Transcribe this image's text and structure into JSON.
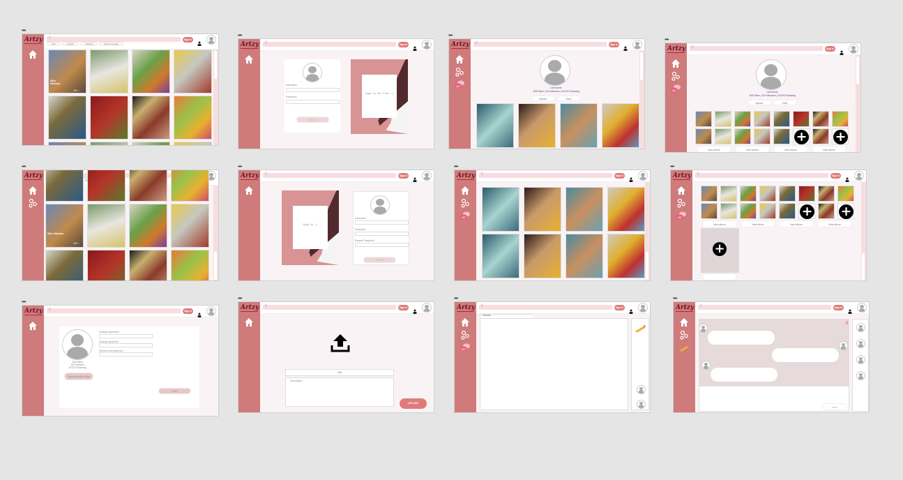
{
  "app": {
    "logo": "Artzy",
    "signin_label": "Sign In",
    "search_placeholder": ""
  },
  "feed": {
    "tabs": [
      "Post",
      "Artwork",
      "Abstract",
      "Most art people"
    ],
    "featured_author": "Silke Slavisku",
    "featured_likes": "100 ♡"
  },
  "login": {
    "username_label": "Username",
    "password_label": "Password",
    "button": "Sign In",
    "promo": "Sign in for Free :)"
  },
  "signup": {
    "username_label": "Username",
    "password_label": "Password",
    "repeat_label": "Repeat Password",
    "button": "Submit",
    "promo": "Sign in :)"
  },
  "profile": {
    "username": "Username",
    "stats": "1000 likes | 18 Followers | 10123 Following",
    "upload": "Upload",
    "save": "Save"
  },
  "albums": {
    "new_album": "New album"
  },
  "settings": {
    "change_username": "Change username",
    "change_password": "Change password",
    "repeat_password": "Repeat new password",
    "likes": "1000 likes",
    "followers": "18 Followers",
    "following": "10123 Following",
    "upload_image": "Upload profile image",
    "save": "Save"
  },
  "upload": {
    "title": "Title",
    "description": "Description",
    "button": "UPLOAD"
  },
  "canvas": {
    "tab": "Canvas"
  },
  "chat": {
    "send": "send"
  },
  "colors": {
    "sidebar": "#cf7b7b",
    "accent": "#e07a7a",
    "search": "#f8dce0",
    "background": "#faf3f5"
  }
}
